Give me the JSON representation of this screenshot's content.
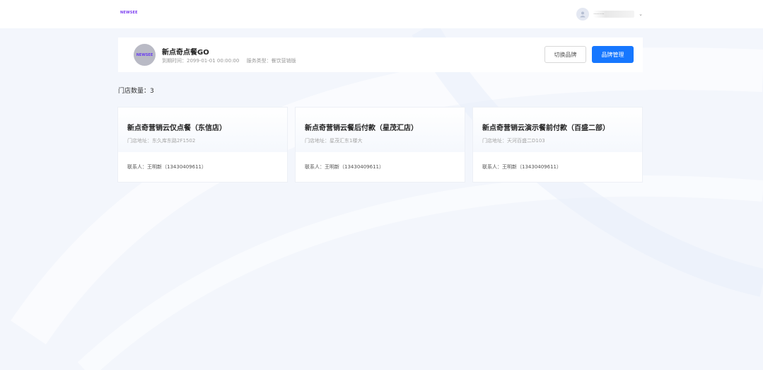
{
  "header": {
    "logo_text": "NEWSEE",
    "user_name": "·······",
    "chevron": "⌄"
  },
  "brand": {
    "logo_text": "NEWSEE",
    "name": "新点奇点餐GO",
    "expire_label": "到期时间：",
    "expire_value": "2099-01-01 00:00:00",
    "service_label": "服务类型：",
    "service_value": "餐饮营销版",
    "switch_button": "切换品牌",
    "manage_button": "品牌管理"
  },
  "store_count": "门店数量：3",
  "stores": [
    {
      "title": "新点奇营销云仅点餐（东信店）",
      "address": "门店地址：东久库东路2F1502",
      "contact": "联系人：王明新（13430409611）"
    },
    {
      "title": "新点奇营销云餐后付款（星茂汇店）",
      "address": "门店地址：星茂汇东1楼大",
      "contact": "联系人：王明新（13430409611）"
    },
    {
      "title": "新点奇营销云演示餐前付款（百盛二部）",
      "address": "门店地址：天河百盛二D103",
      "contact": "联系人：王明新（13430409611）"
    }
  ],
  "colors": {
    "primary": "#1677ff",
    "logo_purple": "#7a3bf0",
    "page_bg": "#f3f6fc"
  }
}
